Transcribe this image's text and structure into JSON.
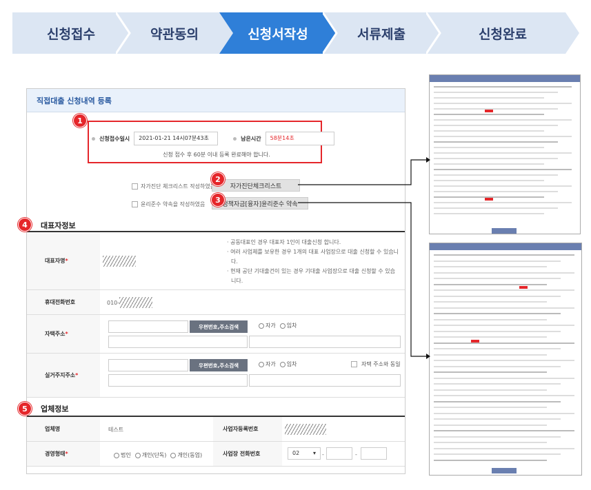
{
  "steps": [
    "신청접수",
    "약관동의",
    "신청서작성",
    "서류제출",
    "신청완료"
  ],
  "active_step": 2,
  "panel": {
    "title": "직접대출 신청내역 등록",
    "apply_date_label": "신청접수일시",
    "apply_date_value": "2021-01-21 14시07분43초",
    "remain_label": "남은시간",
    "remain_value": "58분14초",
    "note": "신청 접수 후 60분 이내 등록 완료해야 합니다.",
    "check1": "자가진단 체크리스트 작성하였음",
    "check2": "윤리준수 약속을 작성하였음",
    "btn_checklist": "자가진단체크리스트",
    "btn_ethics": "정책자금[융자]윤리준수 약속",
    "section_rep": "대표자정보",
    "rep_name_label": "대표자명",
    "rep_notes": [
      "· 공동대표인 경우 대표자 1인이 대출신청 합니다.",
      "· 여러 사업체를 보유한 경우 1개의 대표 사업장으로 대출 신청할 수 있습니",
      "다.",
      "· 현재 공단 기대출건이 있는 경우 기대출 사업장으로 대출 신청할 수 있습",
      "니다."
    ],
    "phone_label": "휴대전화번호",
    "phone_prefix": "010-",
    "home_addr_label": "자택주소",
    "addr_button": "우편번호,주소검색",
    "own": "자가",
    "rent": "임차",
    "living_addr_label": "실거주지주소",
    "same_addr": "자택 주소와 동일",
    "section_biz": "업체정보",
    "biz_name_label": "업체명",
    "biz_name_value": "테스트",
    "biz_reg_label": "사업자등록번호",
    "biz_type_label": "경영형태",
    "biz_types": [
      "법인",
      "개인(단독)",
      "개인(동업)"
    ],
    "biz_phone_label": "사업장 전화번호",
    "biz_phone_area": "02",
    "dash": "-"
  },
  "badges": [
    "1",
    "2",
    "3",
    "4",
    "5"
  ],
  "colors": {
    "accent": "#e5262a",
    "step_fill": "#dce6f3",
    "step_active": "#2f7fd8"
  }
}
